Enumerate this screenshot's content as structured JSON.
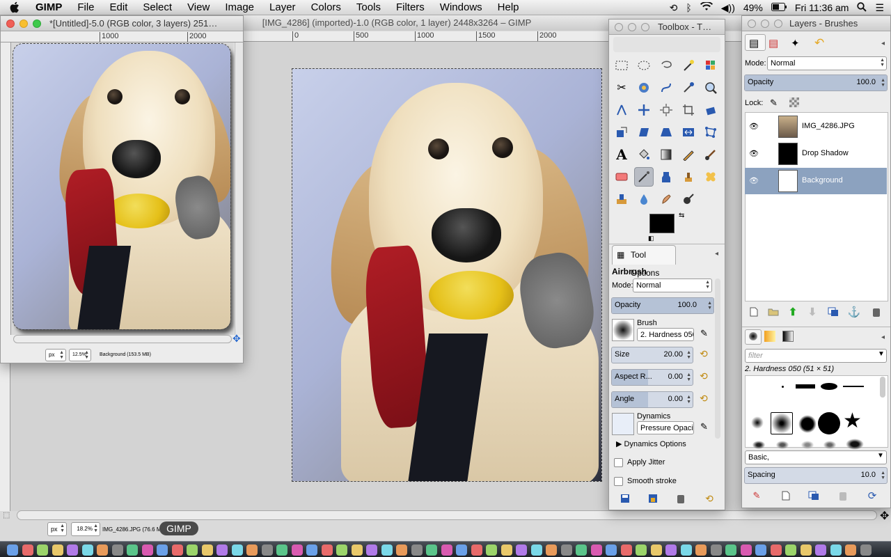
{
  "menubar": {
    "app_name": "GIMP",
    "menus": [
      "File",
      "Edit",
      "Select",
      "View",
      "Image",
      "Layer",
      "Colors",
      "Tools",
      "Filters",
      "Windows",
      "Help"
    ],
    "battery": "49%",
    "clock": "Fri 11:36 am"
  },
  "main_window": {
    "title": "[IMG_4286] (imported)-1.0 (RGB color, 1 layer) 2448x3264 – GIMP",
    "ruler_ticks": [
      "0",
      "500",
      "1000",
      "1500",
      "2000"
    ],
    "unit": "px",
    "zoom": "18.2%",
    "status": "IMG_4286.JPG (76.6 MB)",
    "dock_tooltip": "GIMP"
  },
  "untitled_window": {
    "title": "*[Untitled]-5.0 (RGB color, 3 layers) 251…",
    "ruler_ticks": [
      "1000",
      "2000"
    ],
    "unit": "px",
    "zoom": "12.5%",
    "status": "Background (153.5 MB)"
  },
  "toolbox": {
    "title": "Toolbox - T…",
    "tool_options_tab": "Tool Options",
    "tool_name": "Airbrush",
    "mode_label": "Mode:",
    "mode_value": "Normal",
    "opacity_label": "Opacity",
    "opacity_value": "100.0",
    "brush_label": "Brush",
    "brush_value": "2. Hardness 050",
    "size_label": "Size",
    "size_value": "20.00",
    "aspect_label": "Aspect R...",
    "aspect_value": "0.00",
    "angle_label": "Angle",
    "angle_value": "0.00",
    "dynamics_label": "Dynamics",
    "dynamics_value": "Pressure Opacit",
    "dynamics_options": "Dynamics Options",
    "apply_jitter": "Apply Jitter",
    "smooth_stroke": "Smooth stroke",
    "fg_color": "#000000",
    "bg_color": "#ffffff"
  },
  "layers_panel": {
    "title": "Layers - Brushes",
    "mode_label": "Mode:",
    "mode_value": "Normal",
    "opacity_label": "Opacity",
    "opacity_value": "100.0",
    "lock_label": "Lock:",
    "layers": [
      {
        "name": "IMG_4286.JPG",
        "selected": false
      },
      {
        "name": "Drop Shadow",
        "selected": false
      },
      {
        "name": "Background",
        "selected": true
      }
    ]
  },
  "brushes_panel": {
    "filter_placeholder": "filter",
    "brush_title": "2. Hardness 050 (51 × 51)",
    "brush_set": "Basic,",
    "spacing_label": "Spacing",
    "spacing_value": "10.0"
  }
}
